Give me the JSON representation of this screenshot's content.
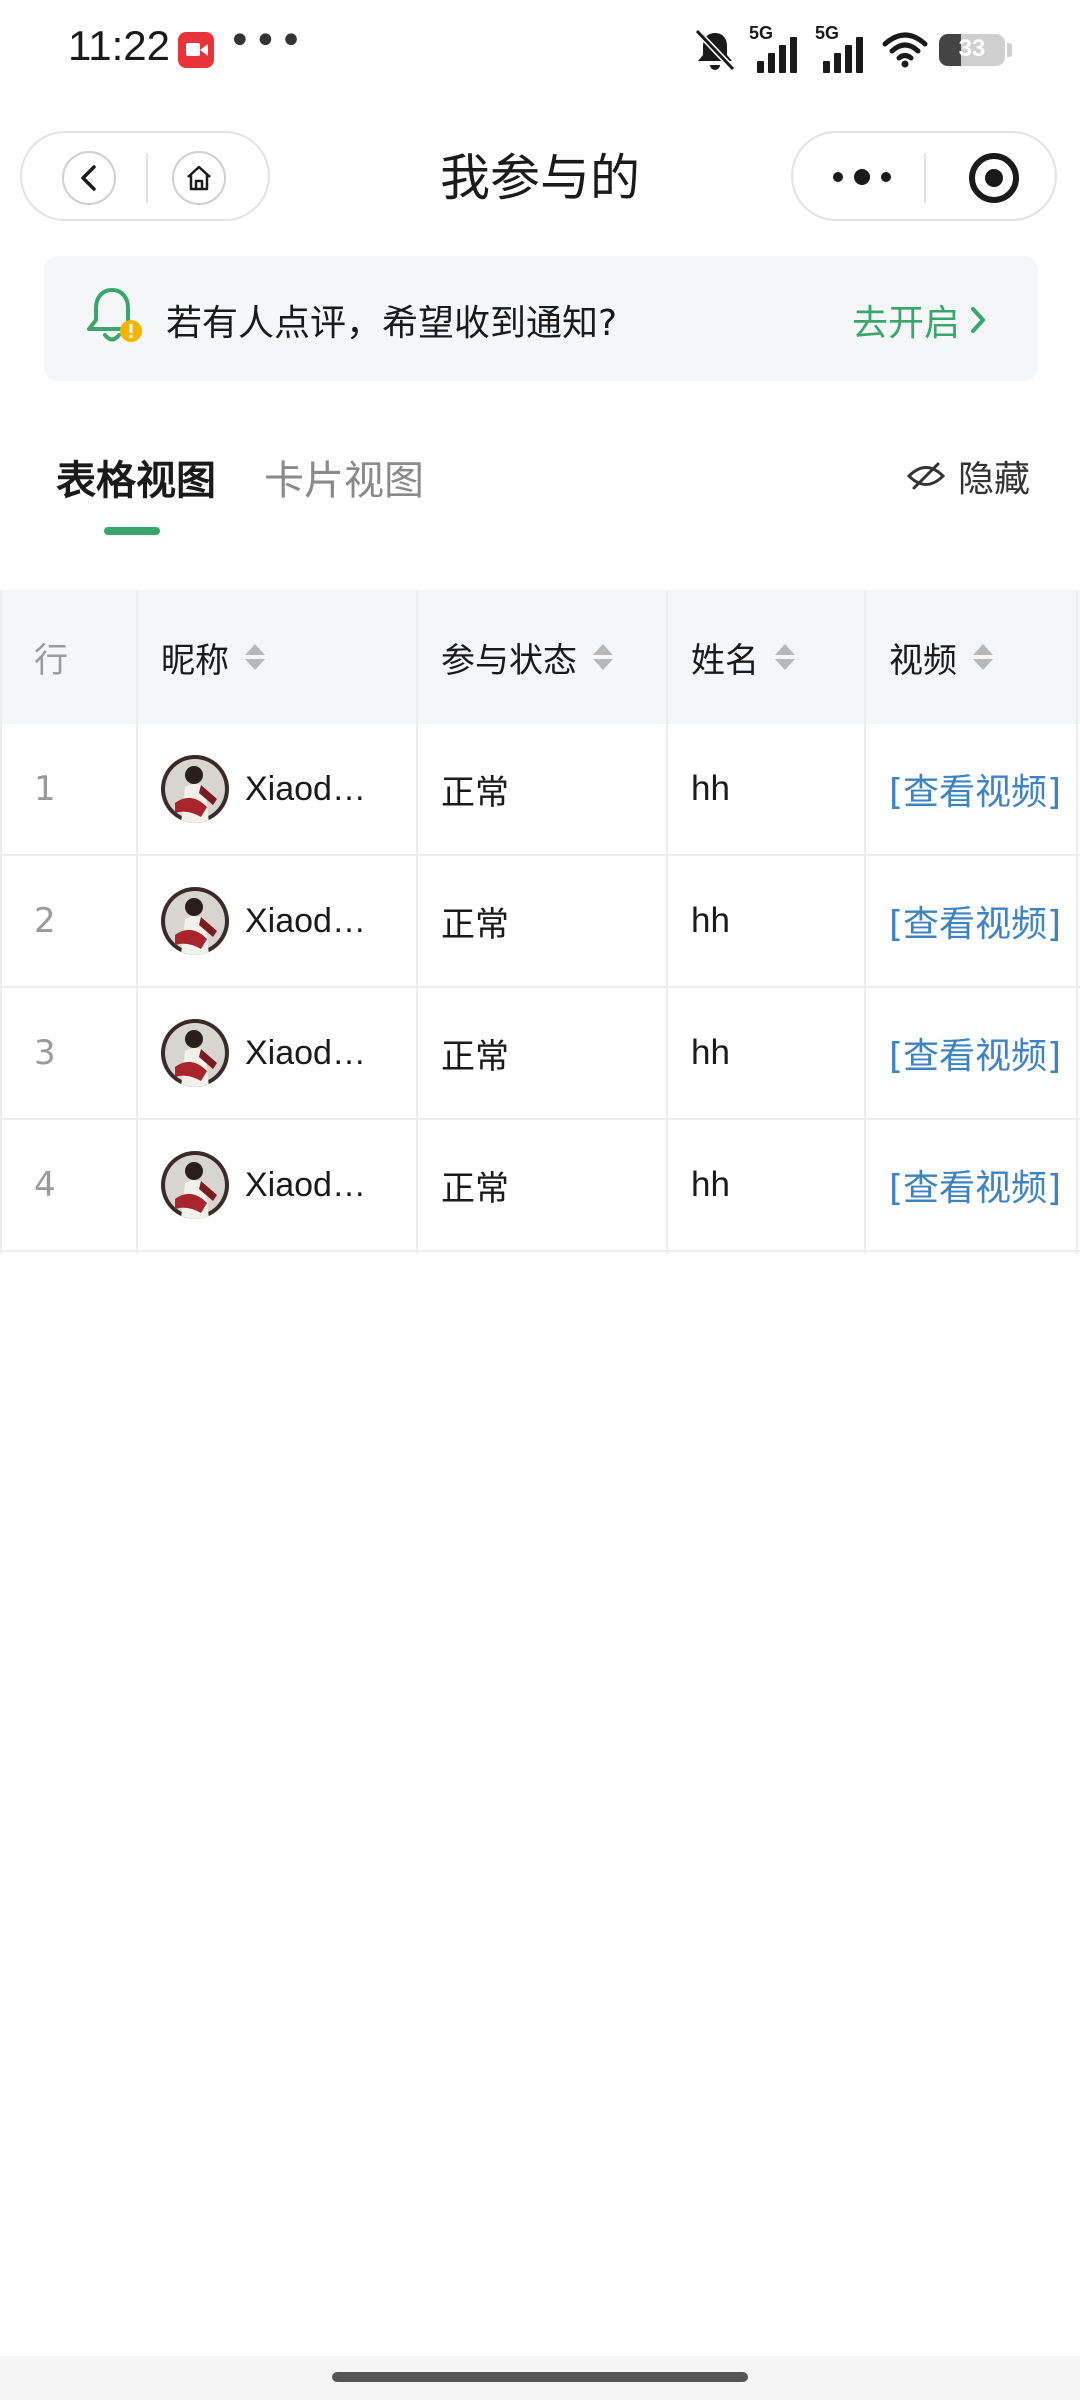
{
  "status_bar": {
    "time": "11:22",
    "more": "•••",
    "network_1": "5G",
    "network_2": "5G",
    "battery_level": 33,
    "battery_text": "33"
  },
  "nav": {
    "title": "我参与的",
    "back_icon": "chevron-left-icon",
    "home_icon": "home-icon",
    "menu_icon": "more-dots-icon",
    "close_icon": "target-icon"
  },
  "banner": {
    "text": "若有人点评，希望收到通知?",
    "action": "去开启",
    "accent_color": "#3aa66d",
    "warning_color": "#f4b400"
  },
  "tabs": {
    "active": "表格视图",
    "inactive": "卡片视图",
    "hide_label": "隐藏"
  },
  "table": {
    "headers": [
      "行",
      "昵称",
      "参与状态",
      "姓名",
      "视频"
    ],
    "link_color": "#3d83c4",
    "rows": [
      {
        "row": "1",
        "nickname": "Xiaodo…",
        "status": "正常",
        "name": "hh",
        "video": "[查看视频]"
      },
      {
        "row": "2",
        "nickname": "Xiaodo…",
        "status": "正常",
        "name": "hh",
        "video": "[查看视频]"
      },
      {
        "row": "3",
        "nickname": "Xiaodo…",
        "status": "正常",
        "name": "hh",
        "video": "[查看视频]"
      },
      {
        "row": "4",
        "nickname": "Xiaodo…",
        "status": "正常",
        "name": "hh",
        "video": "[查看视频]"
      }
    ]
  }
}
